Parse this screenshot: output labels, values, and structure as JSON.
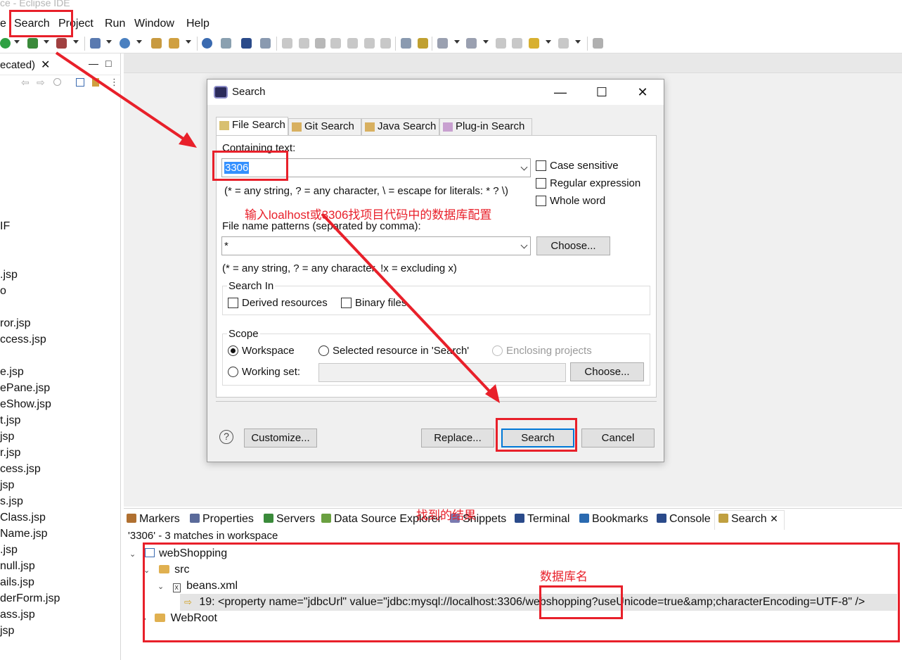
{
  "window": {
    "title_fragment": "ce - Eclipse IDE"
  },
  "menubar": {
    "items": [
      {
        "label": "e"
      },
      {
        "label": "Search"
      },
      {
        "label": "Project"
      },
      {
        "label": "Run"
      },
      {
        "label": "Window"
      },
      {
        "label": "Help"
      }
    ]
  },
  "left_panel": {
    "tab_label": "ecated)",
    "tab_close": "✕",
    "minimize": "—",
    "maximize": "□",
    "items": [
      "IF",
      ".jsp",
      "o",
      "ror.jsp",
      "ccess.jsp",
      "e.jsp",
      "ePane.jsp",
      "eShow.jsp",
      "t.jsp",
      "jsp",
      "r.jsp",
      "cess.jsp",
      "jsp",
      "s.jsp",
      "Class.jsp",
      "Name.jsp",
      ".jsp",
      "null.jsp",
      "ails.jsp",
      "derForm.jsp",
      "ass.jsp",
      "jsp"
    ]
  },
  "dialog": {
    "title": "Search",
    "minimize": "—",
    "maximize": "☐",
    "close": "✕",
    "tabs": [
      {
        "label": "File Search",
        "active": true
      },
      {
        "label": "Git Search",
        "active": false
      },
      {
        "label": "Java Search",
        "active": false
      },
      {
        "label": "Plug-in Search",
        "active": false
      }
    ],
    "containing_text_label": "Containing text:",
    "containing_text_value": "3306",
    "containing_hint": "(* = any string, ? = any character, \\ = escape for literals: * ? \\)",
    "options": [
      {
        "label": "Case sensitive",
        "checked": false
      },
      {
        "label": "Regular expression",
        "checked": false
      },
      {
        "label": "Whole word",
        "checked": false
      }
    ],
    "file_patterns_label": "File name patterns (separated by comma):",
    "file_patterns_value": "*",
    "choose_label": "Choose...",
    "file_patterns_hint": "(* = any string, ? = any character, !x = excluding x)",
    "search_in_label": "Search In",
    "derived_label": "Derived resources",
    "binary_label": "Binary files",
    "scope_label": "Scope",
    "scope_workspace": "Workspace",
    "scope_selected": "Selected resource in 'Search'",
    "scope_enclosing": "Enclosing projects",
    "scope_working_set": "Working set:",
    "scope_choose": "Choose...",
    "customize_label": "Customize...",
    "replace_label": "Replace...",
    "search_label": "Search",
    "cancel_label": "Cancel",
    "help_label": "?"
  },
  "bottom_views": {
    "tabs": [
      {
        "label": "Markers",
        "color": "#b07030"
      },
      {
        "label": "Properties",
        "color": "#5a6a9a"
      },
      {
        "label": "Servers",
        "color": "#3a8a3a"
      },
      {
        "label": "Data Source Explorer",
        "color": "#6aa040"
      },
      {
        "label": "Snippets",
        "color": "#7a7ab0"
      },
      {
        "label": "Terminal",
        "color": "#2a4a8a"
      },
      {
        "label": "Bookmarks",
        "color": "#2a6ab0"
      },
      {
        "label": "Console",
        "color": "#2a4a8a"
      },
      {
        "label": "Search",
        "color": "#c0a040"
      }
    ],
    "search_tab_close": "✕",
    "summary": "'3306' - 3 matches in workspace",
    "tree": {
      "project": "webShopping",
      "src": "src",
      "file": "beans.xml",
      "match": "19: <property name=\"jdbcUrl\" value=\"jdbc:mysql://localhost:3306/webshopping?useUnicode=true&amp;characterEncoding=UTF-8\" />",
      "webroot": "WebRoot"
    }
  },
  "annotations": {
    "input_hint": "输入loalhost或3306找项目代码中的数据库配置",
    "found_result": "找到的结果",
    "db_name": "数据库名",
    "annotation_color": "#e8202a"
  }
}
